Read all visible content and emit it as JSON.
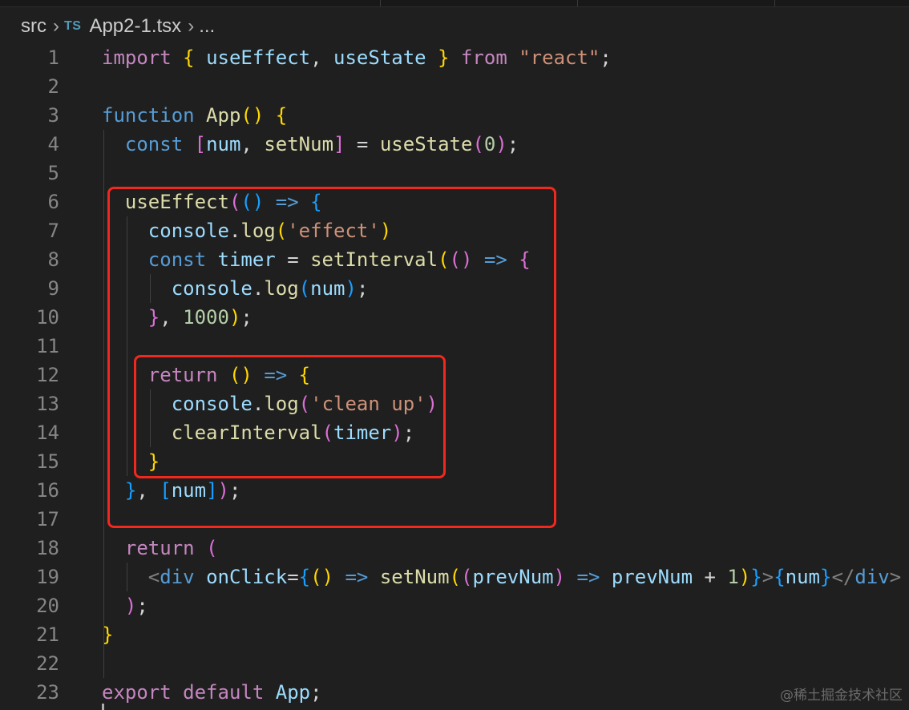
{
  "breadcrumb": {
    "folder": "src",
    "lang_badge": "TS",
    "file": "App2-1.tsx",
    "ellipsis": "..."
  },
  "icons": {
    "separator": "chevron-right-icon",
    "file_type": "typescript-icon"
  },
  "colors": {
    "highlight_box": "#f0281e",
    "background": "#1f1f1f"
  },
  "lines": [
    {
      "n": "1",
      "tokens": [
        [
          "kw",
          "import"
        ],
        [
          "pun",
          " "
        ],
        [
          "b1",
          "{"
        ],
        [
          "pun",
          " "
        ],
        [
          "var",
          "useEffect"
        ],
        [
          "pun",
          ", "
        ],
        [
          "var",
          "useState"
        ],
        [
          "pun",
          " "
        ],
        [
          "b1",
          "}"
        ],
        [
          "pun",
          " "
        ],
        [
          "kw",
          "from"
        ],
        [
          "pun",
          " "
        ],
        [
          "str",
          "\"react\""
        ],
        [
          "pun",
          ";"
        ]
      ]
    },
    {
      "n": "2",
      "tokens": []
    },
    {
      "n": "3",
      "tokens": [
        [
          "st",
          "function"
        ],
        [
          "pun",
          " "
        ],
        [
          "fn",
          "App"
        ],
        [
          "b1",
          "()"
        ],
        [
          "pun",
          " "
        ],
        [
          "b1",
          "{"
        ]
      ]
    },
    {
      "n": "4",
      "tokens": [
        [
          "pun",
          "  "
        ],
        [
          "st",
          "const"
        ],
        [
          "pun",
          " "
        ],
        [
          "b2",
          "["
        ],
        [
          "var",
          "num"
        ],
        [
          "pun",
          ", "
        ],
        [
          "fn",
          "setNum"
        ],
        [
          "b2",
          "]"
        ],
        [
          "pun",
          " = "
        ],
        [
          "fn",
          "useState"
        ],
        [
          "b2",
          "("
        ],
        [
          "num",
          "0"
        ],
        [
          "b2",
          ")"
        ],
        [
          "pun",
          ";"
        ]
      ]
    },
    {
      "n": "5",
      "tokens": []
    },
    {
      "n": "6",
      "tokens": [
        [
          "pun",
          "  "
        ],
        [
          "fn",
          "useEffect"
        ],
        [
          "b2",
          "("
        ],
        [
          "b3",
          "()"
        ],
        [
          "pun",
          " "
        ],
        [
          "st",
          "=>"
        ],
        [
          "pun",
          " "
        ],
        [
          "b3",
          "{"
        ]
      ]
    },
    {
      "n": "7",
      "tokens": [
        [
          "pun",
          "    "
        ],
        [
          "var",
          "console"
        ],
        [
          "pun",
          "."
        ],
        [
          "fn",
          "log"
        ],
        [
          "b1",
          "("
        ],
        [
          "str",
          "'effect'"
        ],
        [
          "b1",
          ")"
        ]
      ]
    },
    {
      "n": "8",
      "tokens": [
        [
          "pun",
          "    "
        ],
        [
          "st",
          "const"
        ],
        [
          "pun",
          " "
        ],
        [
          "var",
          "timer"
        ],
        [
          "pun",
          " = "
        ],
        [
          "fn",
          "setInterval"
        ],
        [
          "b1",
          "("
        ],
        [
          "b2",
          "()"
        ],
        [
          "pun",
          " "
        ],
        [
          "st",
          "=>"
        ],
        [
          "pun",
          " "
        ],
        [
          "b2",
          "{"
        ]
      ]
    },
    {
      "n": "9",
      "tokens": [
        [
          "pun",
          "      "
        ],
        [
          "var",
          "console"
        ],
        [
          "pun",
          "."
        ],
        [
          "fn",
          "log"
        ],
        [
          "b3",
          "("
        ],
        [
          "var",
          "num"
        ],
        [
          "b3",
          ")"
        ],
        [
          "pun",
          ";"
        ]
      ]
    },
    {
      "n": "10",
      "tokens": [
        [
          "pun",
          "    "
        ],
        [
          "b2",
          "}"
        ],
        [
          "pun",
          ", "
        ],
        [
          "num",
          "1000"
        ],
        [
          "b1",
          ")"
        ],
        [
          "pun",
          ";"
        ]
      ]
    },
    {
      "n": "11",
      "tokens": []
    },
    {
      "n": "12",
      "tokens": [
        [
          "pun",
          "    "
        ],
        [
          "kw",
          "return"
        ],
        [
          "pun",
          " "
        ],
        [
          "b1",
          "()"
        ],
        [
          "pun",
          " "
        ],
        [
          "st",
          "=>"
        ],
        [
          "pun",
          " "
        ],
        [
          "b1",
          "{"
        ]
      ]
    },
    {
      "n": "13",
      "tokens": [
        [
          "pun",
          "      "
        ],
        [
          "var",
          "console"
        ],
        [
          "pun",
          "."
        ],
        [
          "fn",
          "log"
        ],
        [
          "b2",
          "("
        ],
        [
          "str",
          "'clean up'"
        ],
        [
          "b2",
          ")"
        ]
      ]
    },
    {
      "n": "14",
      "tokens": [
        [
          "pun",
          "      "
        ],
        [
          "fn",
          "clearInterval"
        ],
        [
          "b2",
          "("
        ],
        [
          "var",
          "timer"
        ],
        [
          "b2",
          ")"
        ],
        [
          "pun",
          ";"
        ]
      ]
    },
    {
      "n": "15",
      "tokens": [
        [
          "pun",
          "    "
        ],
        [
          "b1",
          "}"
        ]
      ]
    },
    {
      "n": "16",
      "tokens": [
        [
          "pun",
          "  "
        ],
        [
          "b3",
          "}"
        ],
        [
          "pun",
          ", "
        ],
        [
          "b3",
          "["
        ],
        [
          "var",
          "num"
        ],
        [
          "b3",
          "]"
        ],
        [
          "b2",
          ")"
        ],
        [
          "pun",
          ";"
        ]
      ]
    },
    {
      "n": "17",
      "tokens": []
    },
    {
      "n": "18",
      "tokens": [
        [
          "pun",
          "  "
        ],
        [
          "kw",
          "return"
        ],
        [
          "pun",
          " "
        ],
        [
          "b2",
          "("
        ]
      ]
    },
    {
      "n": "19",
      "tokens": [
        [
          "pun",
          "    "
        ],
        [
          "tag",
          "<"
        ],
        [
          "tagname",
          "div"
        ],
        [
          "pun",
          " "
        ],
        [
          "var",
          "onClick"
        ],
        [
          "pun",
          "="
        ],
        [
          "b3",
          "{"
        ],
        [
          "b1",
          "()"
        ],
        [
          "pun",
          " "
        ],
        [
          "st",
          "=>"
        ],
        [
          "pun",
          " "
        ],
        [
          "fn",
          "setNum"
        ],
        [
          "b1",
          "("
        ],
        [
          "b2",
          "("
        ],
        [
          "var",
          "prevNum"
        ],
        [
          "b2",
          ")"
        ],
        [
          "pun",
          " "
        ],
        [
          "st",
          "=>"
        ],
        [
          "pun",
          " "
        ],
        [
          "var",
          "prevNum"
        ],
        [
          "pun",
          " + "
        ],
        [
          "num",
          "1"
        ],
        [
          "b1",
          ")"
        ],
        [
          "b3",
          "}"
        ],
        [
          "tag",
          ">"
        ],
        [
          "b3",
          "{"
        ],
        [
          "var",
          "num"
        ],
        [
          "b3",
          "}"
        ],
        [
          "tag",
          "</"
        ],
        [
          "tagname",
          "div"
        ],
        [
          "tag",
          ">"
        ]
      ]
    },
    {
      "n": "20",
      "tokens": [
        [
          "pun",
          "  "
        ],
        [
          "b2",
          ")"
        ],
        [
          "pun",
          ";"
        ]
      ]
    },
    {
      "n": "21",
      "tokens": [
        [
          "b1",
          "}"
        ]
      ]
    },
    {
      "n": "22",
      "tokens": []
    },
    {
      "n": "23",
      "tokens": [
        [
          "kw",
          "export"
        ],
        [
          "pun",
          " "
        ],
        [
          "kw",
          "default"
        ],
        [
          "pun",
          " "
        ],
        [
          "var",
          "App"
        ],
        [
          "pun",
          ";"
        ]
      ]
    }
  ],
  "watermark": "@稀土掘金技术社区"
}
